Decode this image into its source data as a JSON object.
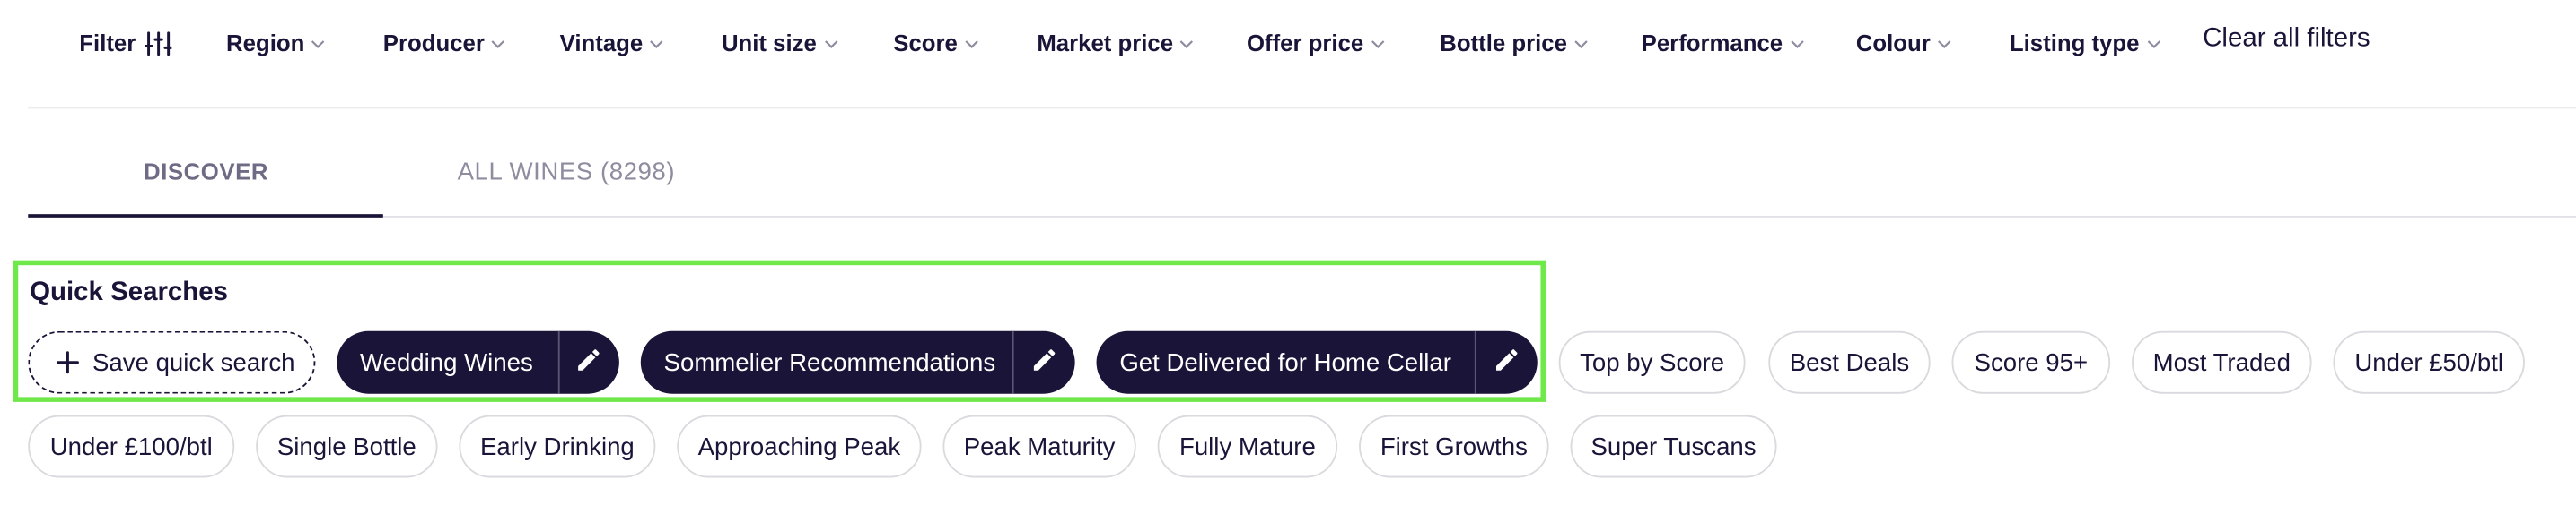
{
  "filter_bar": {
    "filter_label": "Filter",
    "items": [
      {
        "label": "Region"
      },
      {
        "label": "Producer"
      },
      {
        "label": "Vintage"
      },
      {
        "label": "Unit size"
      },
      {
        "label": "Score"
      },
      {
        "label": "Market price"
      },
      {
        "label": "Offer price"
      },
      {
        "label": "Bottle price"
      },
      {
        "label": "Performance"
      },
      {
        "label": "Colour"
      },
      {
        "label": "Listing type"
      }
    ],
    "clear_all": "Clear all filters"
  },
  "tabs": [
    {
      "label": "DISCOVER",
      "active": true
    },
    {
      "label": "ALL WINES (8298)",
      "active": false
    }
  ],
  "quick_searches": {
    "heading": "Quick Searches",
    "save_label": "Save quick search",
    "saved": [
      {
        "label": "Wedding Wines"
      },
      {
        "label": "Sommelier Recommendations"
      },
      {
        "label": "Get Delivered for Home Cellar"
      }
    ],
    "suggestions": [
      {
        "label": "Top by Score"
      },
      {
        "label": "Best Deals"
      },
      {
        "label": "Score 95+"
      },
      {
        "label": "Most Traded"
      },
      {
        "label": "Under £50/btl"
      },
      {
        "label": "Under £100/btl"
      },
      {
        "label": "Single Bottle"
      },
      {
        "label": "Early Drinking"
      },
      {
        "label": "Approaching Peak"
      },
      {
        "label": "Peak Maturity"
      },
      {
        "label": "Fully Mature"
      },
      {
        "label": "First Growths"
      },
      {
        "label": "Super Tuscans"
      }
    ]
  },
  "colors": {
    "navy": "#1a1438",
    "highlight": "#6fe84a",
    "chip_border": "#d9d9de"
  }
}
